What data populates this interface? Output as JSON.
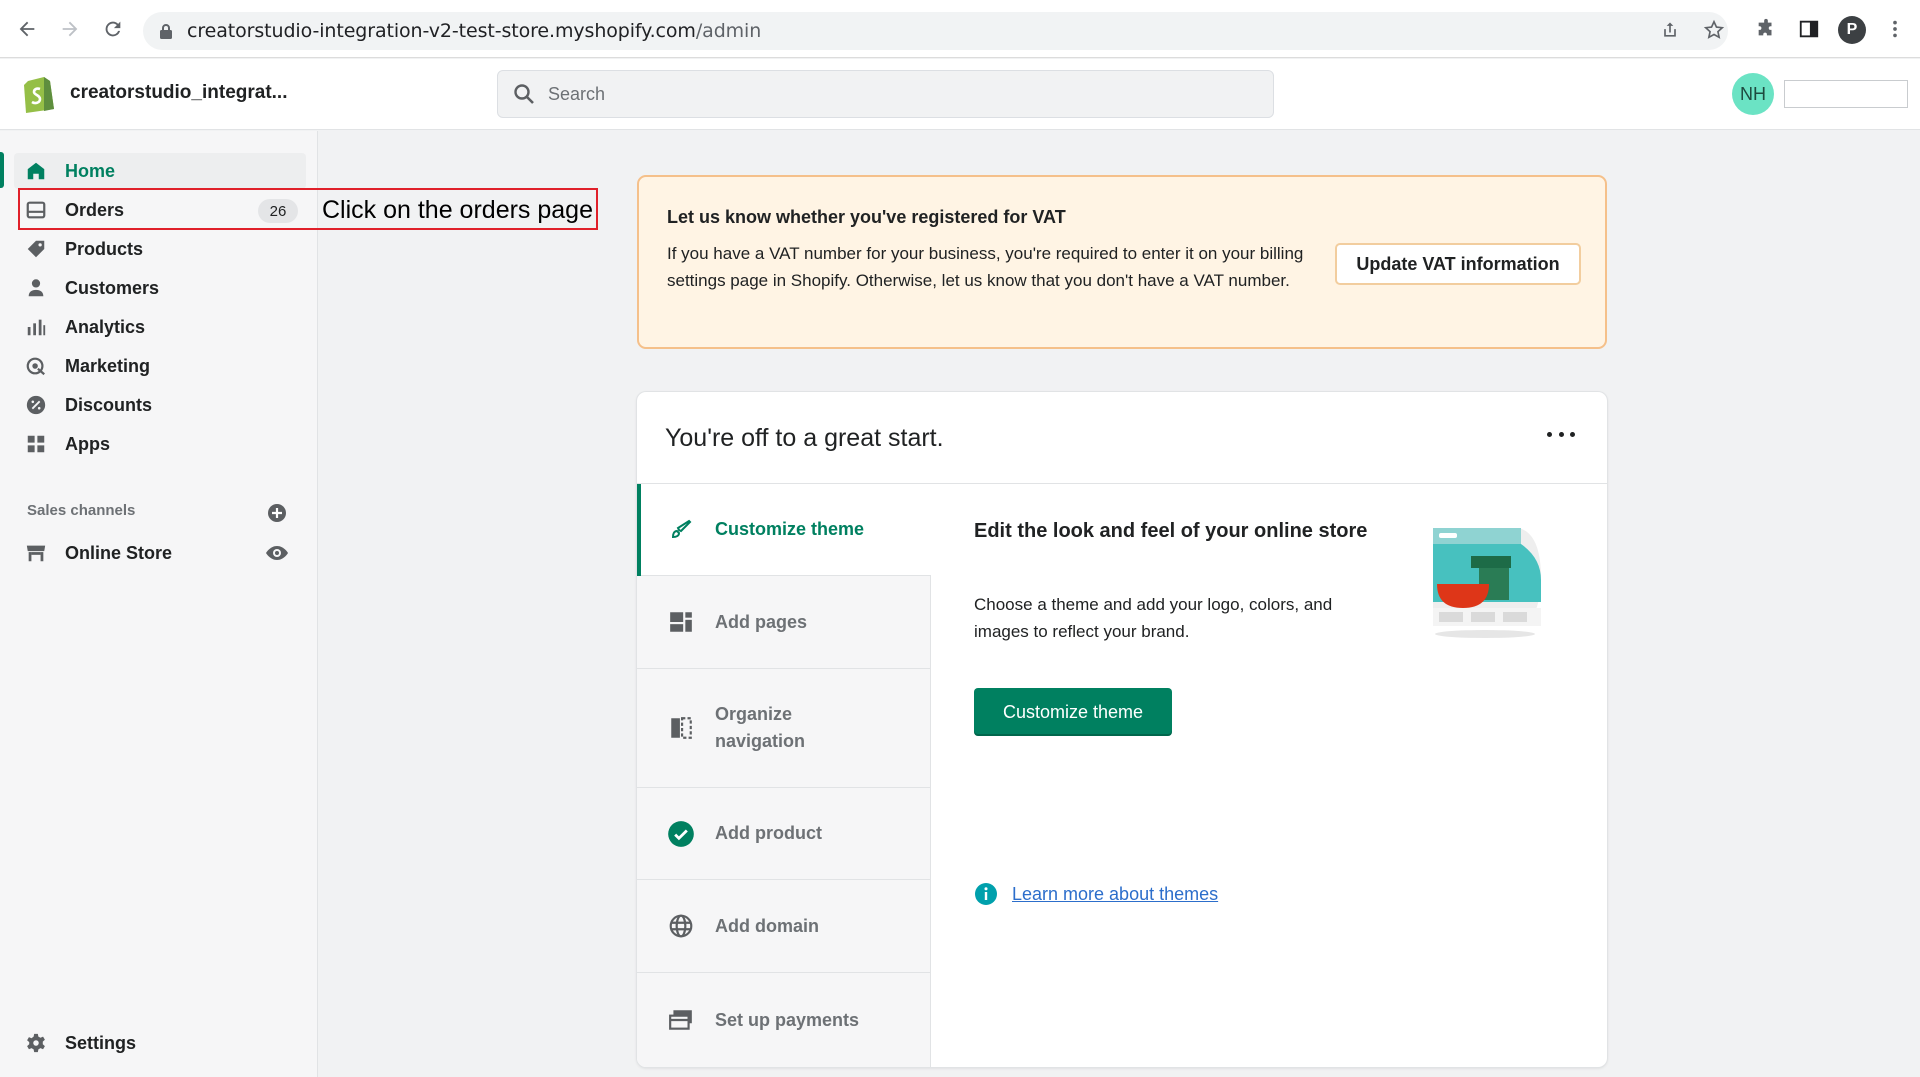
{
  "browser": {
    "url_host": "creatorstudio-integration-v2-test-store.myshopify.com",
    "url_path": "/admin",
    "profile_initial": "P"
  },
  "topbar": {
    "store_name": "creatorstudio_integrat...",
    "search_placeholder": "Search",
    "avatar_initials": "NH"
  },
  "sidebar": {
    "items": [
      {
        "label": "Home",
        "icon": "home-icon",
        "active": true
      },
      {
        "label": "Orders",
        "icon": "orders-icon",
        "badge": "26"
      },
      {
        "label": "Products",
        "icon": "tag-icon"
      },
      {
        "label": "Customers",
        "icon": "person-icon"
      },
      {
        "label": "Analytics",
        "icon": "bar-chart-icon"
      },
      {
        "label": "Marketing",
        "icon": "target-icon"
      },
      {
        "label": "Discounts",
        "icon": "discount-icon"
      },
      {
        "label": "Apps",
        "icon": "apps-icon"
      }
    ],
    "sales_channels_label": "Sales channels",
    "online_store_label": "Online Store",
    "settings_label": "Settings"
  },
  "annotation": {
    "text": "Click on the orders page"
  },
  "vat_banner": {
    "title": "Let us know whether you've registered for VAT",
    "body": "If you have a VAT number for your business, you're required to enter it on your billing settings page in Shopify. Otherwise, let us know that you don't have a VAT number.",
    "button": "Update VAT information",
    "accent": "#f5c08a",
    "background": "#fff4e4"
  },
  "setup_card": {
    "title": "You're off to a great start.",
    "steps": [
      {
        "label": "Customize theme",
        "icon": "brush-icon",
        "active": true
      },
      {
        "label": "Add pages",
        "icon": "pages-icon"
      },
      {
        "label": "Organize navigation",
        "icon": "navigation-icon"
      },
      {
        "label": "Add product",
        "icon": "check-circle-icon",
        "done": true
      },
      {
        "label": "Add domain",
        "icon": "globe-icon"
      },
      {
        "label": "Set up payments",
        "icon": "payments-icon"
      }
    ],
    "detail_title": "Edit the look and feel of your online store",
    "detail_body": "Choose a theme and add your logo, colors, and images to reflect your brand.",
    "primary_button": "Customize theme",
    "learn_more": "Learn more about themes",
    "primary_color": "#008060"
  }
}
